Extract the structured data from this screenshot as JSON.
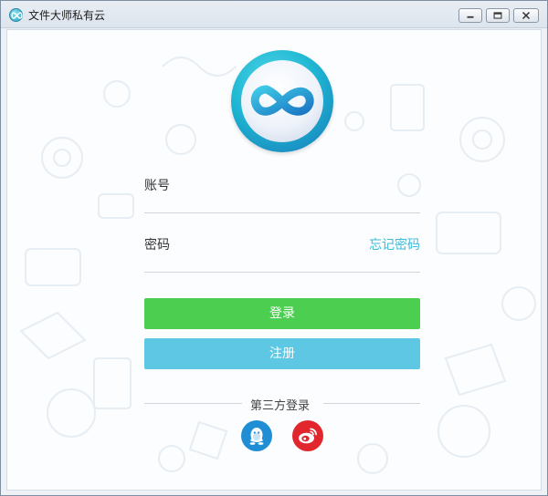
{
  "window": {
    "title": "文件大师私有云",
    "icons": {
      "app": "infinity-logo-icon",
      "minimize": "minimize-icon",
      "maximize": "maximize-icon",
      "close": "close-icon"
    }
  },
  "login": {
    "logo_icon": "infinity-logo-icon",
    "account_label": "账号",
    "account_value": "",
    "password_label": "密码",
    "password_value": "",
    "forgot_password": "忘记密码",
    "login_button": "登录",
    "register_button": "注册"
  },
  "third_party": {
    "label": "第三方登录",
    "providers": [
      {
        "id": "qq",
        "icon": "qq-penguin-icon",
        "color": "#1f8ed4"
      },
      {
        "id": "weibo",
        "icon": "weibo-icon",
        "color": "#e1272d"
      }
    ]
  },
  "colors": {
    "accent_cyan": "#3cbcd6",
    "login_green": "#4ccf50",
    "register_blue": "#5ec7e4"
  }
}
